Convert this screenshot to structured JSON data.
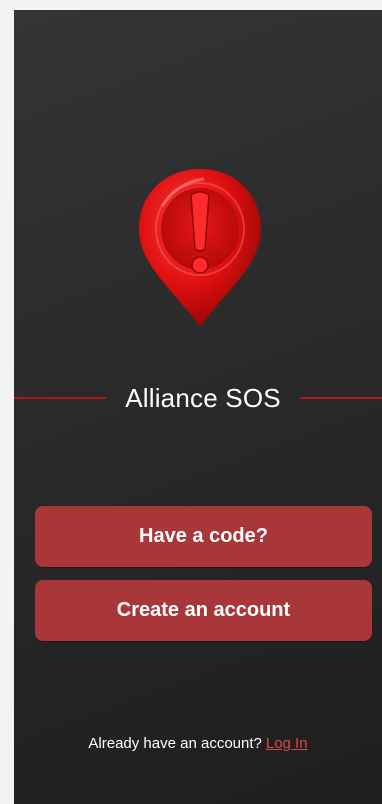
{
  "app": {
    "title": "Alliance SOS",
    "logo_icon": "alert-map-pin-icon"
  },
  "actions": {
    "have_code_label": "Have a code?",
    "create_account_label": "Create an account"
  },
  "footer": {
    "prompt": "Already have an account?",
    "login_label": "Log In"
  },
  "colors": {
    "background": "#2a2a2a",
    "accent": "#a9373a",
    "divider": "#b01818",
    "link": "#d8474b"
  }
}
